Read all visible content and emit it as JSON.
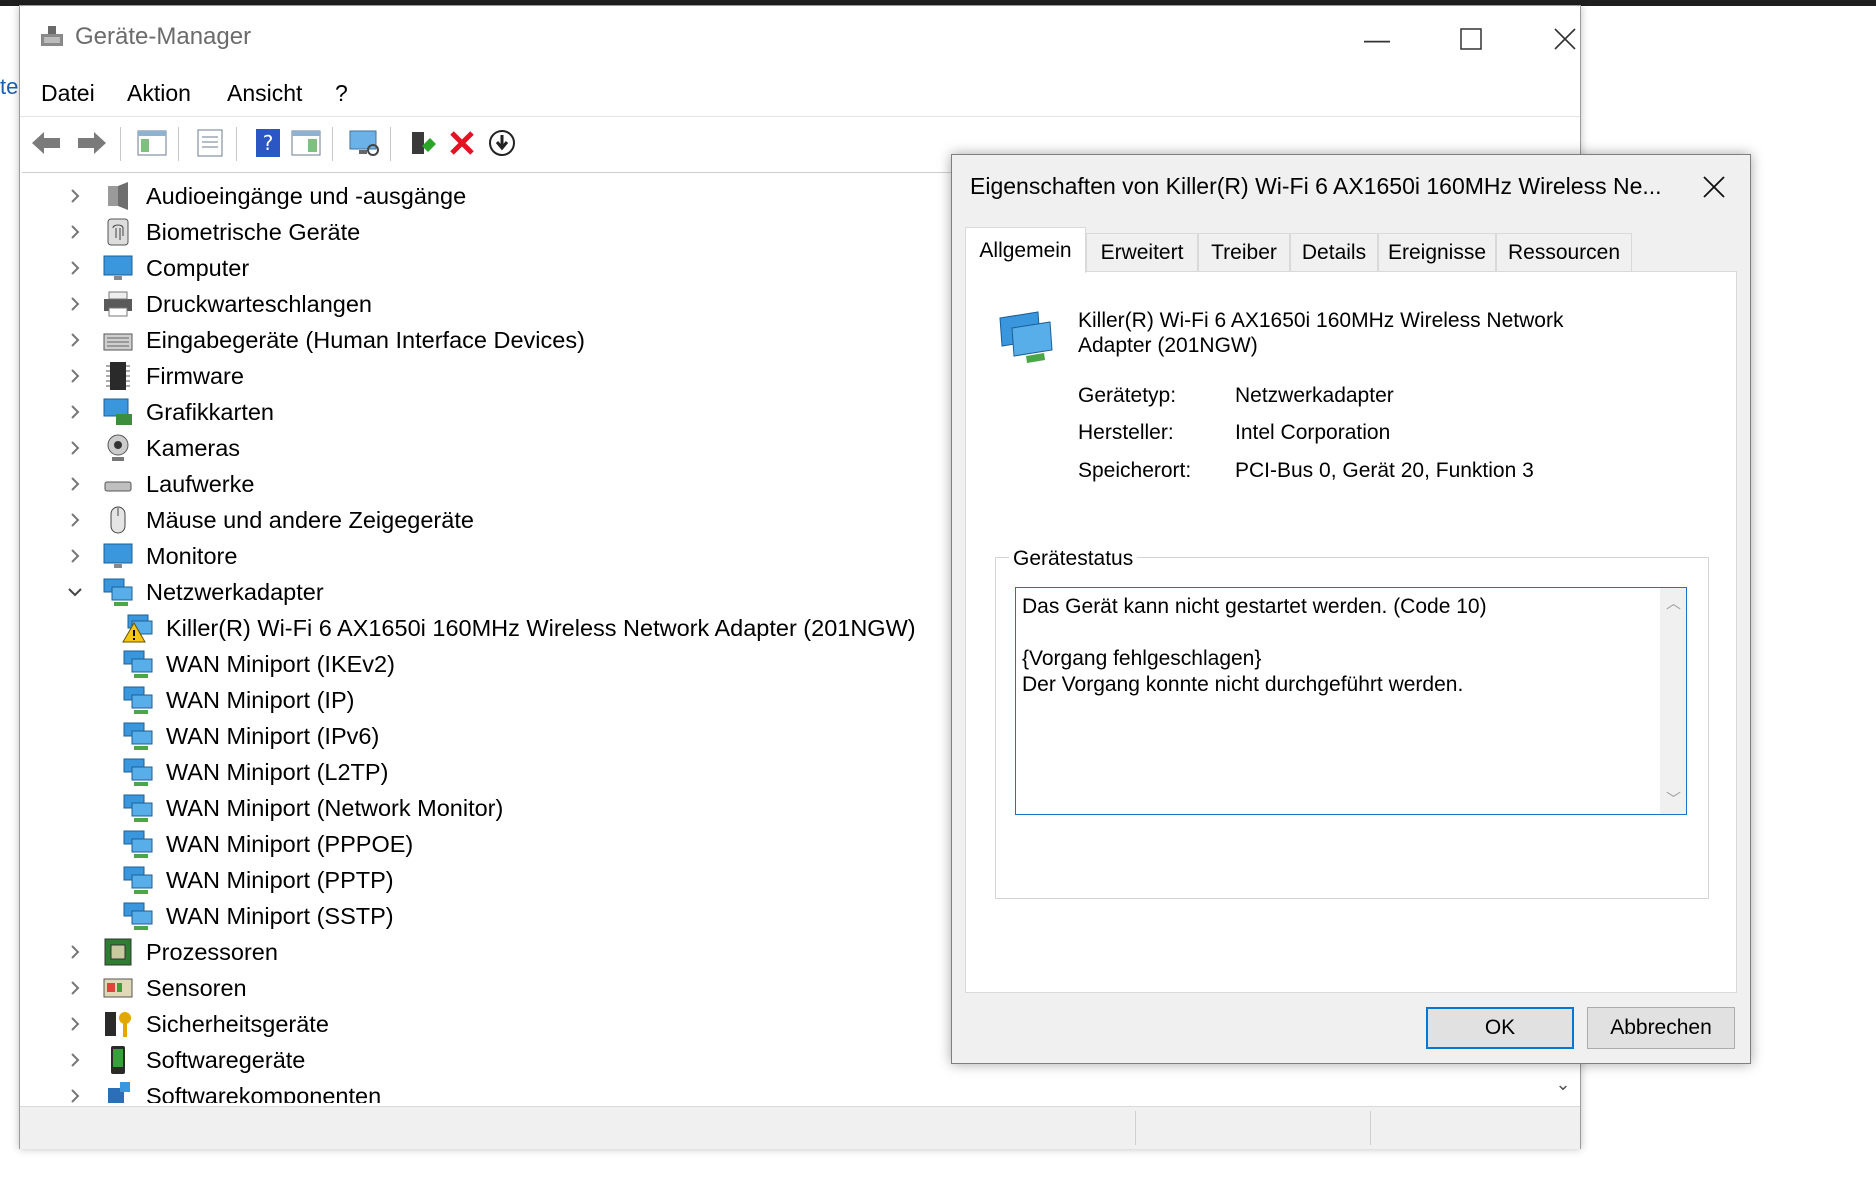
{
  "background": {
    "fragment_text": "te"
  },
  "main_window": {
    "title": "Geräte-Manager",
    "menu": [
      "Datei",
      "Aktion",
      "Ansicht",
      "?"
    ],
    "tree": [
      {
        "label": "Audioeingänge und -ausgänge",
        "icon": "speaker-icon",
        "expanded": false
      },
      {
        "label": "Biometrische Geräte",
        "icon": "fingerprint-icon",
        "expanded": false
      },
      {
        "label": "Computer",
        "icon": "monitor-icon",
        "expanded": false
      },
      {
        "label": "Druckwarteschlangen",
        "icon": "printer-icon",
        "expanded": false
      },
      {
        "label": "Eingabegeräte (Human Interface Devices)",
        "icon": "keyboard-icon",
        "expanded": false
      },
      {
        "label": "Firmware",
        "icon": "chip-icon",
        "expanded": false
      },
      {
        "label": "Grafikkarten",
        "icon": "display-adapter-icon",
        "expanded": false
      },
      {
        "label": "Kameras",
        "icon": "camera-icon",
        "expanded": false
      },
      {
        "label": "Laufwerke",
        "icon": "drive-icon",
        "expanded": false
      },
      {
        "label": "Mäuse und andere Zeigegeräte",
        "icon": "mouse-icon",
        "expanded": false
      },
      {
        "label": "Monitore",
        "icon": "monitor-icon",
        "expanded": false
      },
      {
        "label": "Netzwerkadapter",
        "icon": "network-icon",
        "expanded": true
      },
      {
        "label": "Killer(R) Wi-Fi 6 AX1650i 160MHz Wireless Network Adapter (201NGW)",
        "icon": "network-warning-icon",
        "child": true
      },
      {
        "label": "WAN Miniport (IKEv2)",
        "icon": "network-icon",
        "child": true
      },
      {
        "label": "WAN Miniport (IP)",
        "icon": "network-icon",
        "child": true
      },
      {
        "label": "WAN Miniport (IPv6)",
        "icon": "network-icon",
        "child": true
      },
      {
        "label": "WAN Miniport (L2TP)",
        "icon": "network-icon",
        "child": true
      },
      {
        "label": "WAN Miniport (Network Monitor)",
        "icon": "network-icon",
        "child": true
      },
      {
        "label": "WAN Miniport (PPPOE)",
        "icon": "network-icon",
        "child": true
      },
      {
        "label": "WAN Miniport (PPTP)",
        "icon": "network-icon",
        "child": true
      },
      {
        "label": "WAN Miniport (SSTP)",
        "icon": "network-icon",
        "child": true
      },
      {
        "label": "Prozessoren",
        "icon": "cpu-icon",
        "expanded": false
      },
      {
        "label": "Sensoren",
        "icon": "sensor-icon",
        "expanded": false
      },
      {
        "label": "Sicherheitsgeräte",
        "icon": "security-key-icon",
        "expanded": false
      },
      {
        "label": "Softwaregeräte",
        "icon": "phone-icon",
        "expanded": false
      },
      {
        "label": "Softwarekomponenten",
        "icon": "puzzle-icon",
        "expanded": false
      }
    ]
  },
  "dialog": {
    "title": "Eigenschaften von Killer(R) Wi-Fi 6 AX1650i 160MHz Wireless Ne...",
    "tabs": [
      "Allgemein",
      "Erweitert",
      "Treiber",
      "Details",
      "Ereignisse",
      "Ressourcen"
    ],
    "active_tab": "Allgemein",
    "device_name": "Killer(R) Wi-Fi 6 AX1650i 160MHz Wireless Network Adapter (201NGW)",
    "props": {
      "type_label": "Gerätetyp:",
      "type_value": "Netzwerkadapter",
      "mfr_label": "Hersteller:",
      "mfr_value": "Intel Corporation",
      "loc_label": "Speicherort:",
      "loc_value": "PCI-Bus 0, Gerät 20, Funktion 3"
    },
    "status_group_label": "Gerätestatus",
    "status_text": "Das Gerät kann nicht gestartet werden. (Code 10)\n\n{Vorgang fehlgeschlagen}\nDer Vorgang konnte nicht durchgeführt werden.",
    "ok_label": "OK",
    "cancel_label": "Abbrechen"
  },
  "colors": {
    "accent": "#0078d7",
    "network_blue": "#3a96dd",
    "error_red": "#e81123",
    "warning_yellow": "#f5c518"
  }
}
